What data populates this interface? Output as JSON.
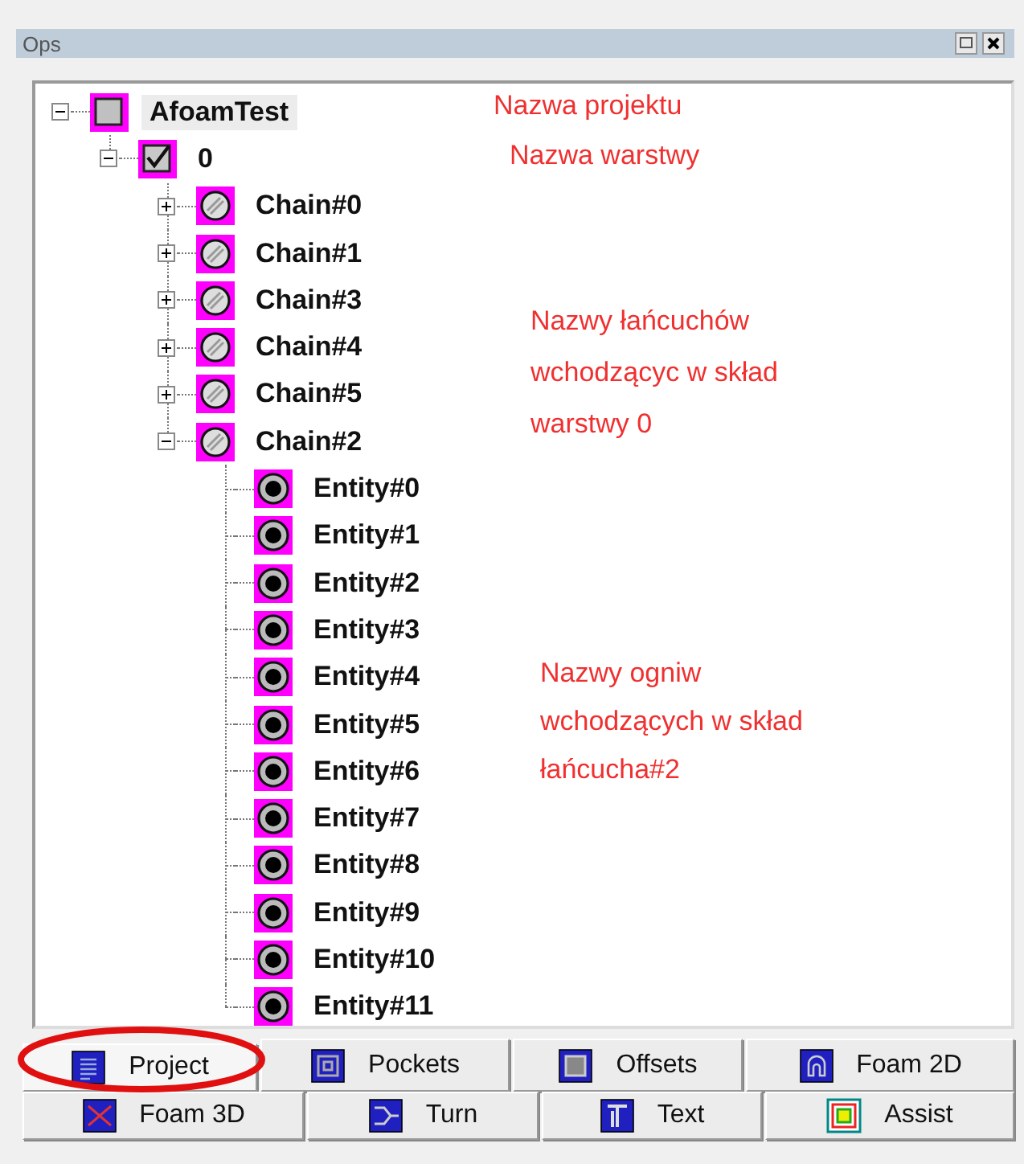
{
  "window": {
    "title": "Ops"
  },
  "tree": [
    {
      "label": "AfoamTest",
      "kind": "project",
      "expanded": true,
      "selected": true,
      "children": [
        {
          "label": "0",
          "kind": "layer",
          "expanded": true,
          "checked": true,
          "selected": false,
          "children": [
            {
              "label": "Chain#0",
              "kind": "chain",
              "expanded": false,
              "selected": false
            },
            {
              "label": "Chain#1",
              "kind": "chain",
              "expanded": false,
              "selected": false
            },
            {
              "label": "Chain#3",
              "kind": "chain",
              "expanded": false,
              "selected": false
            },
            {
              "label": "Chain#4",
              "kind": "chain",
              "expanded": false,
              "selected": false
            },
            {
              "label": "Chain#5",
              "kind": "chain",
              "expanded": false,
              "selected": false
            },
            {
              "label": "Chain#2",
              "kind": "chain",
              "expanded": true,
              "selected": false,
              "children": [
                {
                  "label": "Entity#0",
                  "kind": "entity",
                  "selected": false
                },
                {
                  "label": "Entity#1",
                  "kind": "entity",
                  "selected": false
                },
                {
                  "label": "Entity#2",
                  "kind": "entity",
                  "selected": false
                },
                {
                  "label": "Entity#3",
                  "kind": "entity",
                  "selected": false
                },
                {
                  "label": "Entity#4",
                  "kind": "entity",
                  "selected": false
                },
                {
                  "label": "Entity#5",
                  "kind": "entity",
                  "selected": false
                },
                {
                  "label": "Entity#6",
                  "kind": "entity",
                  "selected": false
                },
                {
                  "label": "Entity#7",
                  "kind": "entity",
                  "selected": false
                },
                {
                  "label": "Entity#8",
                  "kind": "entity",
                  "selected": false
                },
                {
                  "label": "Entity#9",
                  "kind": "entity",
                  "selected": false
                },
                {
                  "label": "Entity#10",
                  "kind": "entity",
                  "selected": false
                },
                {
                  "label": "Entity#11",
                  "kind": "entity",
                  "selected": false
                }
              ]
            }
          ]
        }
      ]
    }
  ],
  "annotations": [
    {
      "lines": [
        "Nazwa projektu"
      ]
    },
    {
      "lines": [
        "Nazwa warstwy"
      ]
    },
    {
      "lines": [
        "Nazwy łańcuchów",
        "wchodzącyc w skład",
        "warstwy 0"
      ]
    },
    {
      "lines": [
        "Nazwy ogniw",
        "wchodzących w skład",
        "łańcucha#2"
      ]
    }
  ],
  "tab_rows": [
    [
      {
        "label": "Project",
        "selected": true
      },
      {
        "label": "Pockets",
        "selected": false
      },
      {
        "label": "Offsets",
        "selected": false
      },
      {
        "label": "Foam 2D",
        "selected": false
      }
    ],
    [
      {
        "label": "Foam 3D",
        "selected": false
      },
      {
        "label": "Turn",
        "selected": false
      },
      {
        "label": "Text",
        "selected": false
      },
      {
        "label": "Assist",
        "selected": false
      }
    ]
  ]
}
